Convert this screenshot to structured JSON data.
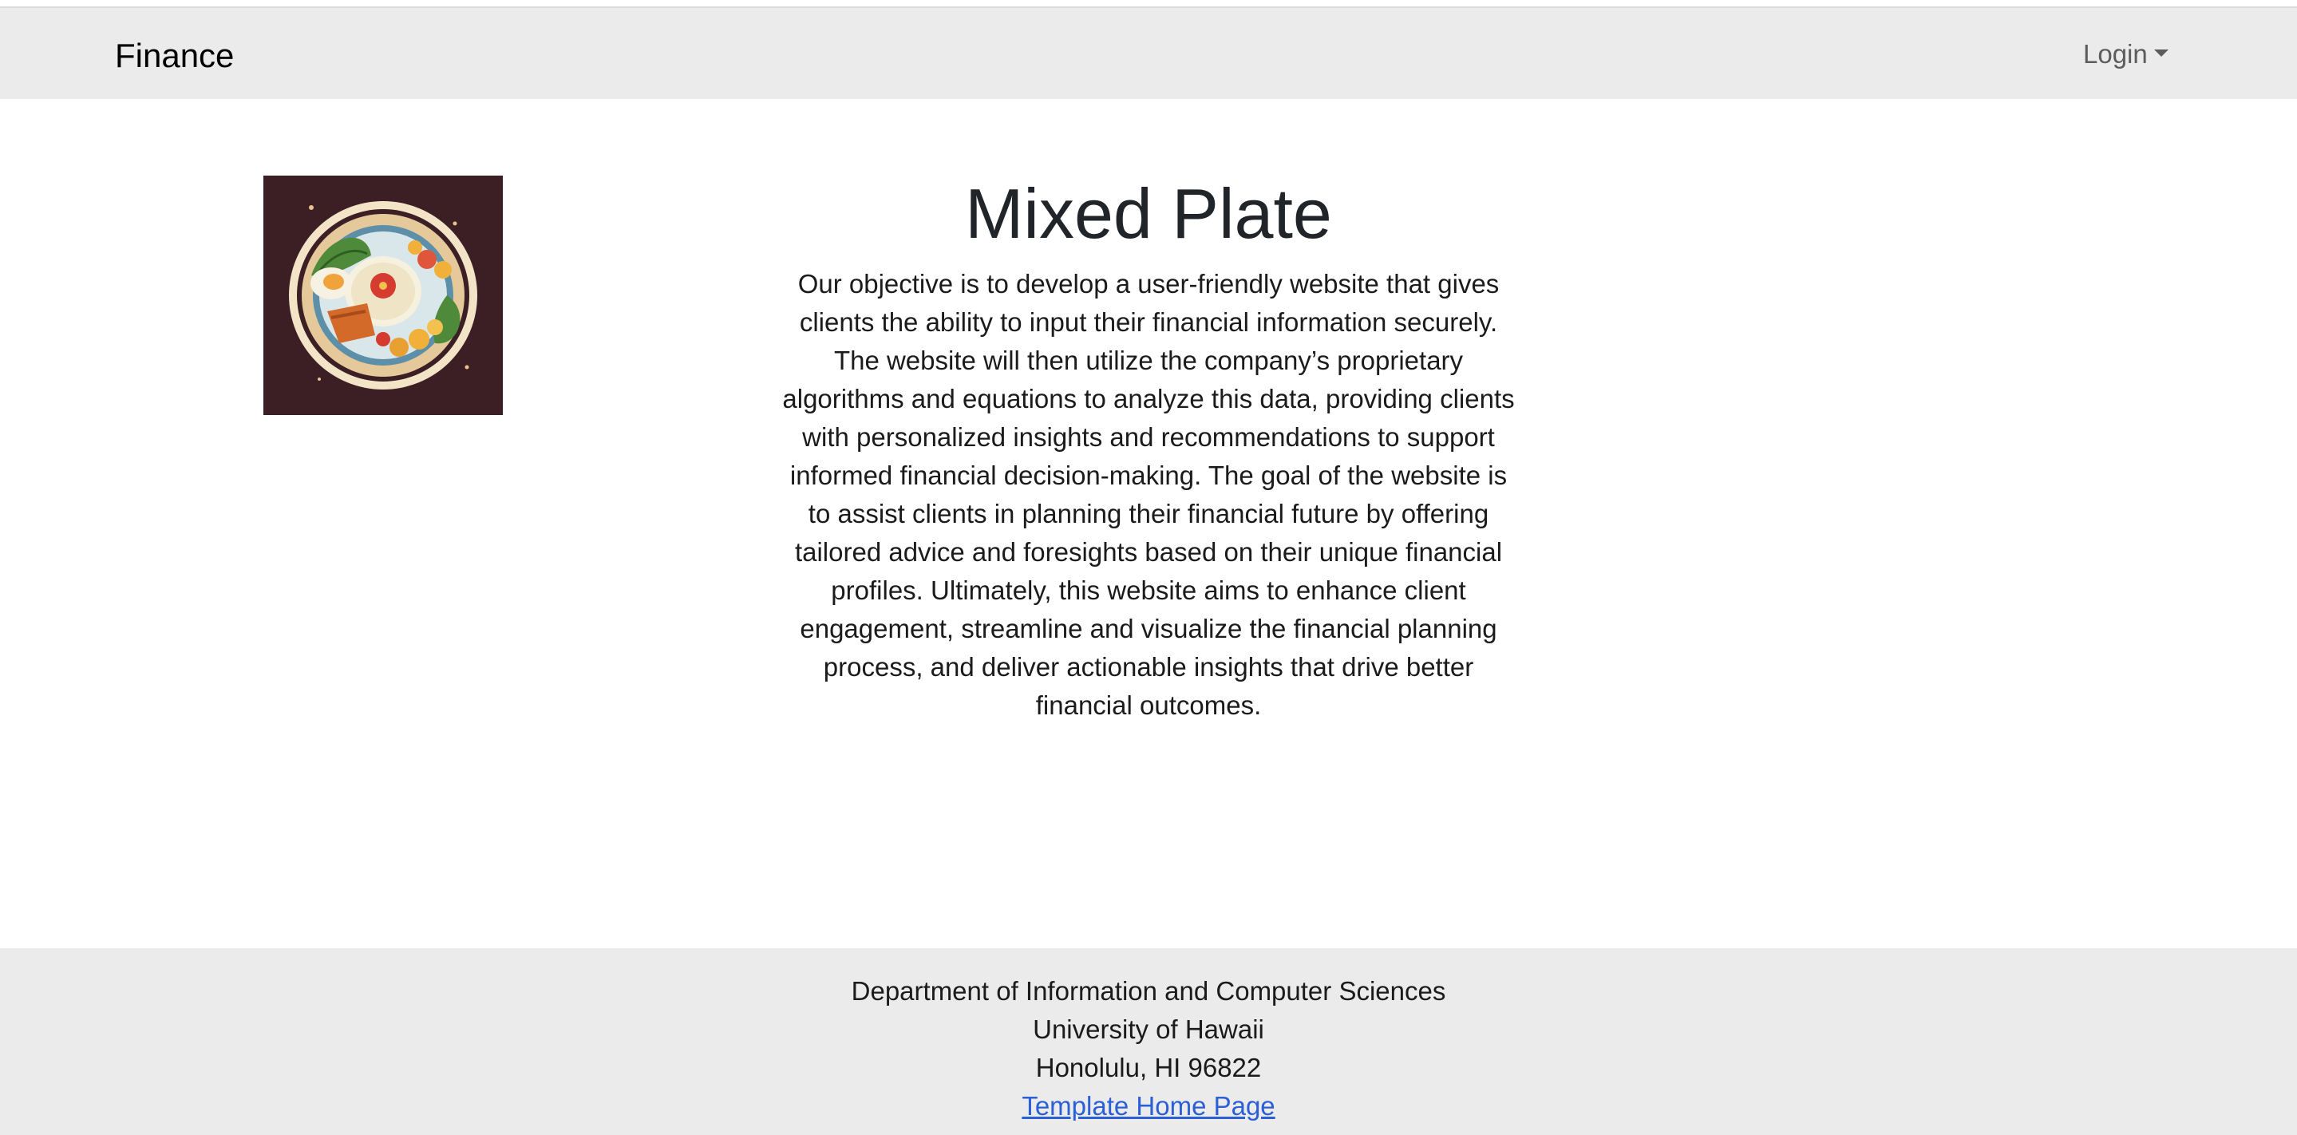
{
  "navbar": {
    "brand": "Finance",
    "login_label": "Login"
  },
  "hero": {
    "title": "Mixed Plate",
    "description": "Our objective is to develop a user-friendly website that gives clients the ability to input their financial information securely. The website will then utilize the company’s proprietary algorithms and equations to analyze this data, providing clients with personalized insights and recommendations to support informed financial decision-making. The goal of the website is to assist clients in planning their financial future by offering tailored advice and foresights based on their unique financial profiles. Ultimately, this website aims to enhance client engagement, streamline and visualize the financial planning process, and deliver actionable insights that drive better financial outcomes."
  },
  "footer": {
    "department": "Department of Information and Computer Sciences",
    "university": "University of Hawaii",
    "address": "Honolulu, HI 96822",
    "link_label": "Template Home Page"
  },
  "colors": {
    "navbar_bg": "#ebebeb",
    "footer_bg": "#ebebeb",
    "logo_bg": "#3b1f25",
    "link": "#2a5fd6"
  },
  "icons": {
    "logo": "mixed-plate-logo",
    "login_caret": "caret-down-icon"
  }
}
